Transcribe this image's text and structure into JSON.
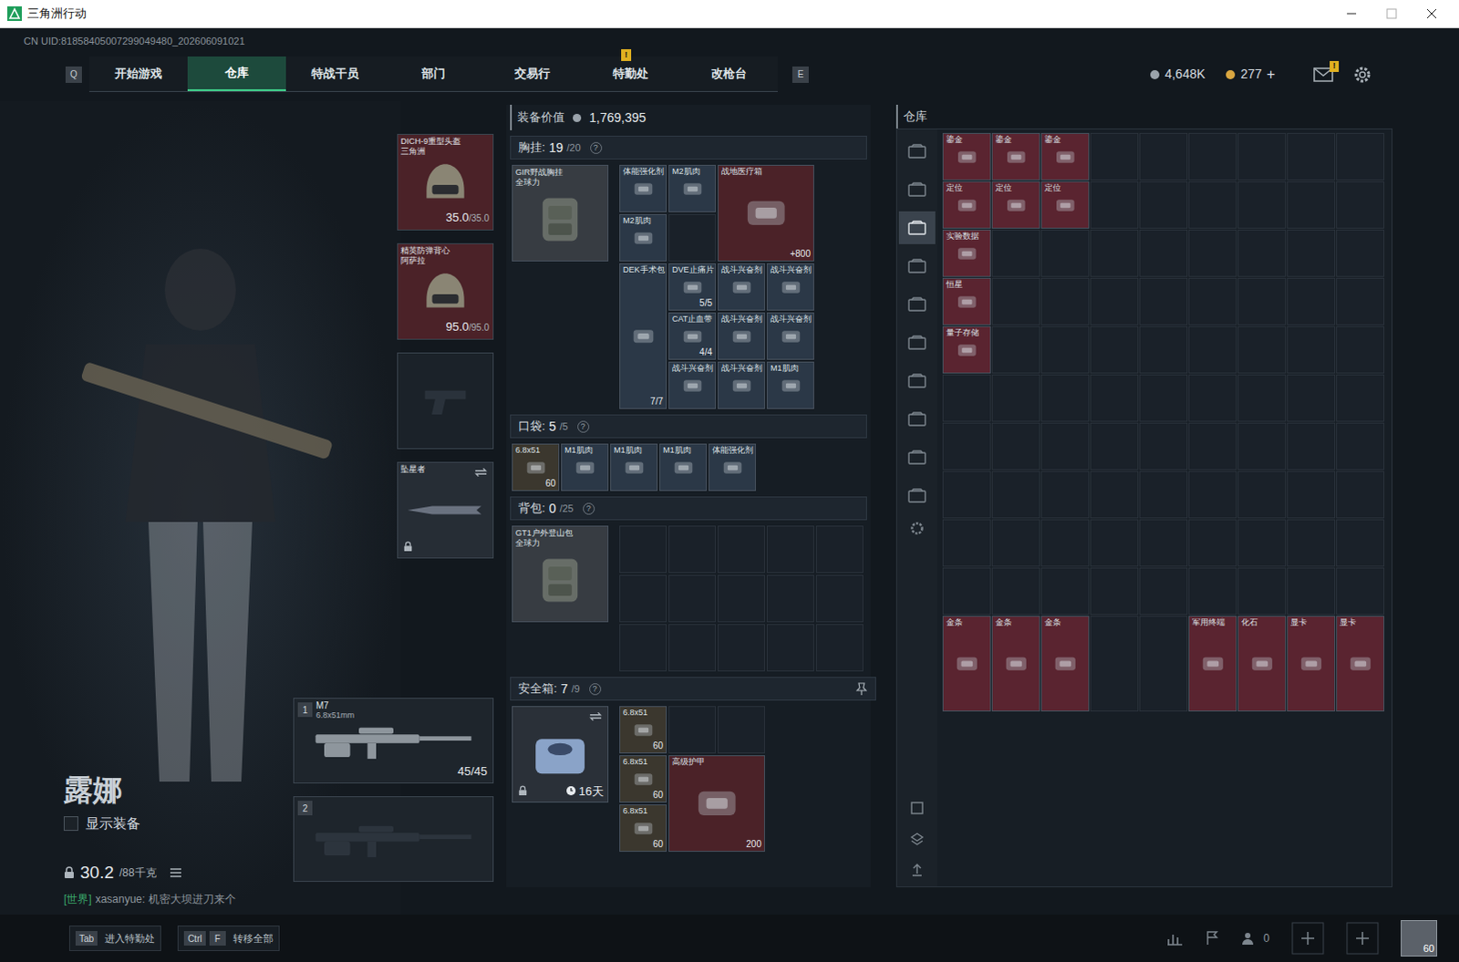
{
  "window": {
    "title": "三角洲行动"
  },
  "uid": "CN UID:81858405007299049480_202606091021",
  "nav": {
    "left_key": "Q",
    "right_key": "E",
    "tabs": [
      {
        "label": "开始游戏",
        "selected": false,
        "badge": ""
      },
      {
        "label": "仓库",
        "selected": true,
        "badge": ""
      },
      {
        "label": "特战干员",
        "selected": false,
        "badge": ""
      },
      {
        "label": "部门",
        "selected": false,
        "badge": ""
      },
      {
        "label": "交易行",
        "selected": false,
        "badge": ""
      },
      {
        "label": "特勤处",
        "selected": false,
        "badge": "!"
      },
      {
        "label": "改枪台",
        "selected": false,
        "badge": ""
      }
    ]
  },
  "currency": [
    {
      "value": "4,648K",
      "color": "#9aa3ab",
      "add": ""
    },
    {
      "value": "277",
      "color": "#d9a640",
      "add": "+"
    }
  ],
  "mail_badge": "!",
  "operator": {
    "name": "露娜",
    "show_gear": {
      "label": "显示装备",
      "checked": false
    },
    "weight": "30.2",
    "weight_max": "/88千克"
  },
  "chat": {
    "channel": "[世界]",
    "text": "xasanyue: 机密大坝进刀来个"
  },
  "equipment": [
    {
      "kind": "gear",
      "name": "DICH-9重型头盔",
      "sub": "三角洲",
      "durability": "35.0",
      "max": "/35.0",
      "color": "#4b2228",
      "locked": false,
      "swap": false
    },
    {
      "kind": "gear",
      "name": "精英防弹背心",
      "sub": "阿萨拉",
      "durability": "95.0",
      "max": "/95.0",
      "color": "#4b2228",
      "locked": false,
      "swap": false
    },
    {
      "kind": "empty",
      "name": "",
      "sub": "",
      "durability": "",
      "max": "",
      "color": "#1b2229",
      "locked": false,
      "swap": false
    },
    {
      "kind": "melee",
      "name": "坠星者",
      "sub": "",
      "durability": "",
      "max": "",
      "color": "#262d35",
      "locked": true,
      "swap": true
    }
  ],
  "weapons": [
    {
      "index": "1",
      "name": "M7",
      "caliber": "6.8x51mm",
      "ammo": "45/45",
      "empty": false
    },
    {
      "index": "2",
      "name": "",
      "caliber": "",
      "ammo": "",
      "empty": true
    }
  ],
  "loadout": {
    "value_label": "装备价值",
    "value": "1,769,395",
    "chest": {
      "label": "胸挂:",
      "count": "19",
      "capacity": "/20",
      "help": "?",
      "container": {
        "name": "GIR野战胸挂",
        "sub": "全球力",
        "color": "#373c42"
      },
      "items": [
        {
          "kind": "small",
          "name": "体能强化剂",
          "count": "",
          "color": "#2b3847"
        },
        {
          "kind": "small",
          "name": "M2肌肉",
          "count": "",
          "color": "#2b3847"
        },
        {
          "kind": "large",
          "name": "战地医疗箱",
          "count": "+800",
          "color": "#4b2228"
        },
        {
          "kind": "small",
          "name": "M2肌肉",
          "count": "",
          "color": "#2b3847"
        },
        {
          "kind": "empty",
          "name": "",
          "count": "",
          "color": "#1a2129"
        },
        {
          "kind": "tall",
          "name": "DEK手术包",
          "count": "7/7",
          "color": "#2b3847"
        },
        {
          "kind": "small",
          "name": "DVE止痛片",
          "count": "5/5",
          "color": "#2b3847"
        },
        {
          "kind": "small",
          "name": "战斗兴奋剂",
          "count": "",
          "color": "#2b3847"
        },
        {
          "kind": "small",
          "name": "战斗兴奋剂",
          "count": "",
          "color": "#2b3847"
        },
        {
          "kind": "small",
          "name": "CAT止血带",
          "count": "4/4",
          "color": "#2b3847"
        },
        {
          "kind": "small",
          "name": "战斗兴奋剂",
          "count": "",
          "color": "#2b3847"
        },
        {
          "kind": "small",
          "name": "战斗兴奋剂",
          "count": "",
          "color": "#2b3847"
        },
        {
          "kind": "small",
          "name": "战斗兴奋剂",
          "count": "",
          "color": "#2b3847"
        },
        {
          "kind": "small",
          "name": "战斗兴奋剂",
          "count": "",
          "color": "#2b3847"
        },
        {
          "kind": "small",
          "name": "M1肌肉",
          "count": "",
          "color": "#2b3847"
        }
      ]
    },
    "pocket": {
      "label": "口袋:",
      "count": "5",
      "capacity": "/5",
      "help": "?",
      "items": [
        {
          "kind": "small",
          "name": "6.8x51",
          "count": "60",
          "color": "#3b372e"
        },
        {
          "kind": "small",
          "name": "M1肌肉",
          "count": "",
          "color": "#2b3847"
        },
        {
          "kind": "small",
          "name": "M1肌肉",
          "count": "",
          "color": "#2b3847"
        },
        {
          "kind": "small",
          "name": "M1肌肉",
          "count": "",
          "color": "#2b3847"
        },
        {
          "kind": "small",
          "name": "体能强化剂",
          "count": "",
          "color": "#2b3847"
        }
      ]
    },
    "backpack": {
      "label": "背包:",
      "count": "0",
      "capacity": "/25",
      "help": "?",
      "container": {
        "name": "GT1户外登山包",
        "sub": "全球力",
        "color": "#373c42"
      }
    },
    "safe": {
      "label": "安全箱:",
      "count": "7",
      "capacity": "/9",
      "help": "?",
      "container": {
        "timer": "16天",
        "color": "#2a3038",
        "locked": true
      },
      "items": [
        {
          "kind": "small",
          "name": "6.8x51",
          "count": "60",
          "color": "#3b372e"
        },
        {
          "kind": "empty",
          "name": "",
          "count": "",
          "color": "#1a2129"
        },
        {
          "kind": "empty",
          "name": "",
          "count": "",
          "color": "#1a2129"
        },
        {
          "kind": "small",
          "name": "6.8x51",
          "count": "60",
          "color": "#3b372e"
        },
        {
          "kind": "large",
          "name": "高级护甲",
          "count": "200",
          "color": "#4b2228"
        },
        {
          "kind": "small",
          "name": "6.8x51",
          "count": "60",
          "color": "#3b372e"
        }
      ]
    }
  },
  "warehouse": {
    "title": "仓库",
    "sidebar": [
      {
        "selected": false
      },
      {
        "selected": false
      },
      {
        "selected": true
      },
      {
        "selected": false
      },
      {
        "selected": false
      },
      {
        "selected": false
      },
      {
        "selected": false
      },
      {
        "selected": false
      },
      {
        "selected": false
      },
      {
        "selected": false
      }
    ],
    "top_rows": [
      [
        {
          "kind": "small",
          "name": "鎏金",
          "color": "#5a2430"
        },
        {
          "kind": "small",
          "name": "鎏金",
          "color": "#5a2430"
        },
        {
          "kind": "small",
          "name": "鎏金",
          "color": "#5a2430"
        }
      ],
      [
        {
          "kind": "small",
          "name": "定位",
          "color": "#5a2430"
        },
        {
          "kind": "small",
          "name": "定位",
          "color": "#5a2430"
        },
        {
          "kind": "small",
          "name": "定位",
          "color": "#5a2430"
        }
      ],
      [
        {
          "kind": "small",
          "name": "实验数据",
          "color": "#5a2430"
        }
      ],
      [
        {
          "kind": "small",
          "name": "恒星",
          "color": "#5a2430"
        }
      ],
      [
        {
          "kind": "small",
          "name": "量子存储",
          "color": "#5a2430"
        }
      ]
    ],
    "bottom_row": [
      {
        "kind": "small",
        "name": "金条",
        "color": "#5a2430"
      },
      {
        "kind": "small",
        "name": "金条",
        "color": "#5a2430"
      },
      {
        "kind": "small",
        "name": "金条",
        "color": "#5a2430"
      },
      {
        "kind": "empty",
        "name": "",
        "color": "#1a2129"
      },
      {
        "kind": "empty",
        "name": "",
        "color": "#1a2129"
      },
      {
        "kind": "small",
        "name": "军用终端",
        "color": "#5a2430"
      },
      {
        "kind": "small",
        "name": "化石",
        "color": "#5a2430"
      },
      {
        "kind": "small",
        "name": "显卡",
        "color": "#5a2430"
      },
      {
        "kind": "small",
        "name": "显卡",
        "color": "#5a2430"
      }
    ]
  },
  "bottom_bar": {
    "hints": [
      {
        "keys": [
          "Tab"
        ],
        "label": "进入特勤处"
      },
      {
        "keys": [
          "Ctrl",
          "F"
        ],
        "label": "转移全部"
      }
    ],
    "friends": "0",
    "avatar_level": "60"
  }
}
